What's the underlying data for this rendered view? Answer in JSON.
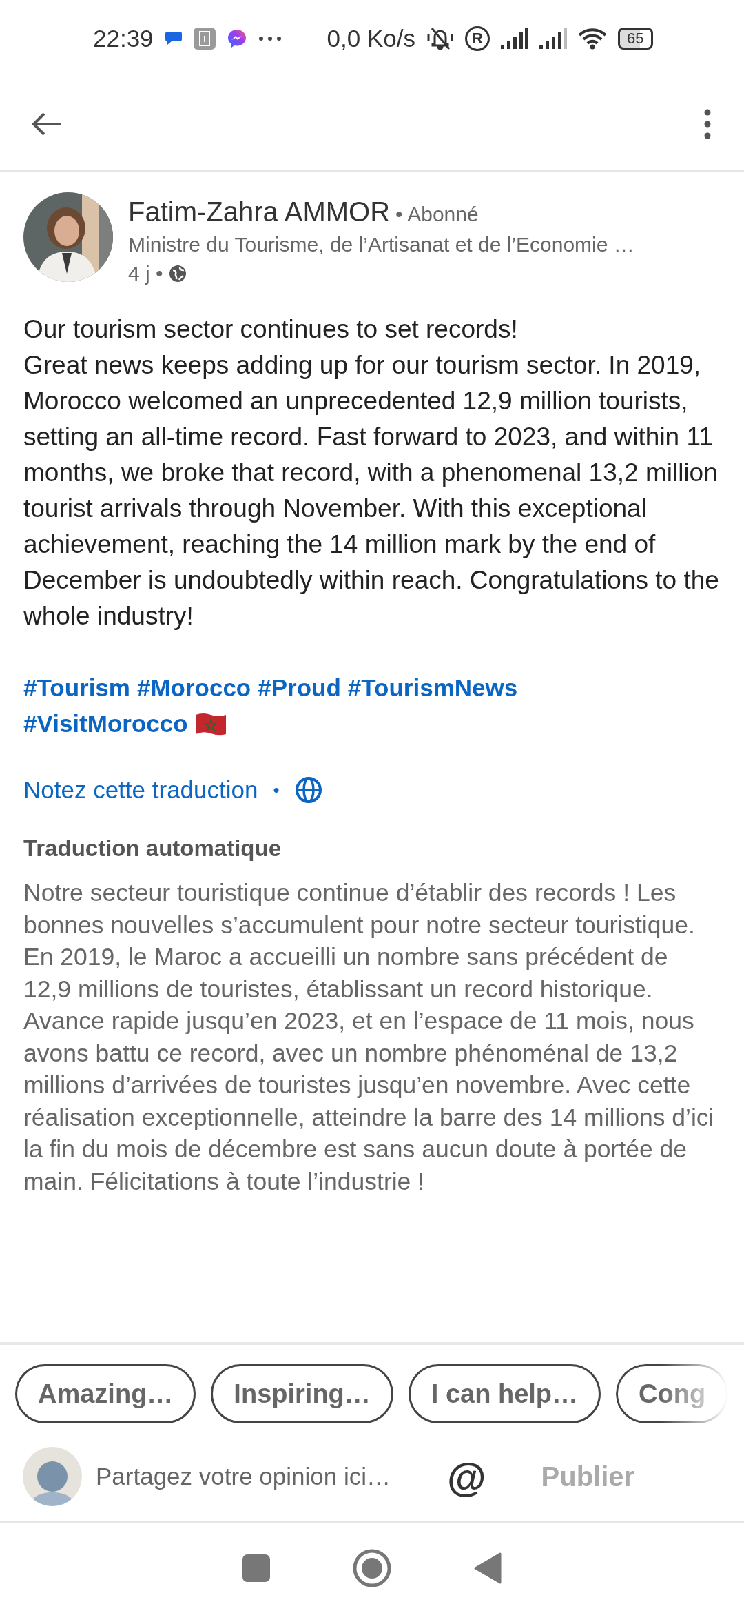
{
  "status_bar": {
    "time": "22:39",
    "speed": "0,0 Ko/s",
    "roaming": "R",
    "battery": "65"
  },
  "author": {
    "name": "Fatim-Zahra AMMOR",
    "relation": "Abonné",
    "relation_dot": "•",
    "age_dot": "•",
    "headline": "Ministre du Tourisme, de l’Artisanat et de l’Economie …",
    "age": "4 j"
  },
  "post": {
    "title": "Our tourism sector continues to set records!",
    "text": "Great news keeps adding up for our tourism sector. In 2019, Morocco welcomed an unprecedented 12,9 million tourists, setting an all-time record. Fast forward to 2023, and within 11 months, we broke that record, with a phenomenal 13,2 million tourist arrivals through November. With this exceptional achievement, reaching the 14 million mark by the end of December is undoubtedly within reach. Congratulations to the whole industry!",
    "hashtags": [
      "#Tourism",
      "#Morocco",
      "#Proud",
      "#TourismNews",
      "#VisitMorocco"
    ]
  },
  "translation": {
    "rate_link": "Notez cette traduction",
    "separator": "•",
    "heading": "Traduction automatique",
    "text": "Notre secteur touristique continue d’établir des records ! Les bonnes nouvelles s’accumulent pour notre secteur touristique. En 2019, le Maroc a accueilli un nombre sans précédent de 12,9 millions de touristes, établissant un record historique. Avance rapide jusqu’en 2023, et en l’espace de 11 mois, nous avons battu ce record, avec un nombre phénoménal de 13,2 millions d’arrivées de touristes jusqu’en novembre. Avec cette réalisation exceptionnelle, atteindre la barre des 14 millions d’ici la fin du mois de décembre est sans aucun doute à portée de main. Félicitations à toute l’industrie !"
  },
  "suggestions": [
    "Amazing…",
    "Inspiring…",
    "I can help…",
    "Cong"
  ],
  "comment": {
    "placeholder": "Partagez votre opinion ici…",
    "mention": "@",
    "submit": "Publier",
    "submit_disabled": true
  }
}
